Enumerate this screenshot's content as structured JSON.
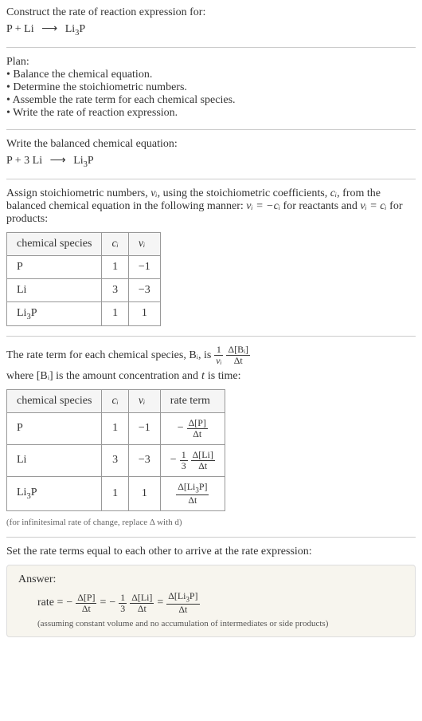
{
  "header": {
    "prompt": "Construct the rate of reaction expression for:",
    "equation_lhs": "P + Li",
    "equation_rhs": "Li₃P"
  },
  "plan": {
    "title": "Plan:",
    "items": [
      "Balance the chemical equation.",
      "Determine the stoichiometric numbers.",
      "Assemble the rate term for each chemical species.",
      "Write the rate of reaction expression."
    ]
  },
  "balanced": {
    "title": "Write the balanced chemical equation:",
    "lhs": "P + 3 Li",
    "rhs": "Li₃P"
  },
  "stoich": {
    "intro_pre": "Assign stoichiometric numbers, ",
    "intro_mid1": ", using the stoichiometric coefficients, ",
    "intro_mid2": ", from the balanced chemical equation in the following manner: ",
    "intro_mid3": " for reactants and ",
    "intro_end": " for products:",
    "nu_i": "νᵢ",
    "c_i": "cᵢ",
    "rel_react": "νᵢ = −cᵢ",
    "rel_prod": "νᵢ = cᵢ",
    "headers": [
      "chemical species",
      "cᵢ",
      "νᵢ"
    ],
    "rows": [
      {
        "species": "P",
        "c": "1",
        "nu": "−1"
      },
      {
        "species": "Li",
        "c": "3",
        "nu": "−3"
      },
      {
        "species": "Li₃P",
        "c": "1",
        "nu": "1"
      }
    ]
  },
  "rateterm": {
    "intro_pre": "The rate term for each chemical species, Bᵢ, is ",
    "intro_post": " where [Bᵢ] is the amount concentration and ",
    "t_var": "t",
    "intro_end": " is time:",
    "frac1_num": "1",
    "frac1_den": "νᵢ",
    "frac2_num": "Δ[Bᵢ]",
    "frac2_den": "Δt",
    "headers": [
      "chemical species",
      "cᵢ",
      "νᵢ",
      "rate term"
    ],
    "rows": [
      {
        "species": "P",
        "c": "1",
        "nu": "−1",
        "sign": "−",
        "coef": "",
        "num": "Δ[P]",
        "den": "Δt"
      },
      {
        "species": "Li",
        "c": "3",
        "nu": "−3",
        "sign": "−",
        "coef_num": "1",
        "coef_den": "3",
        "num": "Δ[Li]",
        "den": "Δt"
      },
      {
        "species": "Li₃P",
        "c": "1",
        "nu": "1",
        "sign": "",
        "coef": "",
        "num": "Δ[Li₃P]",
        "den": "Δt"
      }
    ],
    "footnote": "(for infinitesimal rate of change, replace Δ with d)"
  },
  "final": {
    "intro": "Set the rate terms equal to each other to arrive at the rate expression:"
  },
  "answer": {
    "label": "Answer:",
    "rate_label": "rate = ",
    "term1_sign": "−",
    "term1_num": "Δ[P]",
    "term1_den": "Δt",
    "eq": " = ",
    "term2_sign": "−",
    "term2_coef_num": "1",
    "term2_coef_den": "3",
    "term2_num": "Δ[Li]",
    "term2_den": "Δt",
    "term3_num": "Δ[Li₃P]",
    "term3_den": "Δt",
    "note": "(assuming constant volume and no accumulation of intermediates or side products)"
  }
}
